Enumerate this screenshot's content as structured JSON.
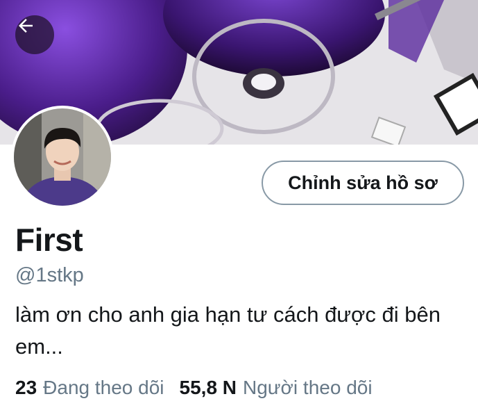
{
  "profile": {
    "name": "First",
    "handle": "@1stkp",
    "bio": "làm ơn cho anh gia hạn tư cách được đi bên em..."
  },
  "actions": {
    "edit_profile_label": "Chỉnh sửa hồ sơ"
  },
  "stats": {
    "following_count": "23",
    "following_label": "Đang theo dõi",
    "followers_count": "55,8 N",
    "followers_label": "Người theo dõi"
  },
  "icons": {
    "back": "arrow-left-icon"
  },
  "colors": {
    "text_primary": "#14171a",
    "text_secondary": "#657786",
    "button_border": "#8899a6",
    "banner_accent": "#5b2a9e"
  }
}
